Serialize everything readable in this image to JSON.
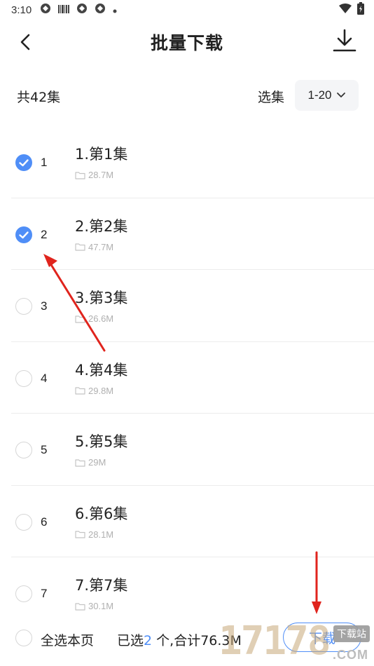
{
  "status_bar": {
    "time": "3:10",
    "left_icons": [
      "sync-icon",
      "barcode-icon",
      "sync-icon",
      "sync-icon",
      "dot-icon"
    ],
    "right_icons": [
      "wifi-icon",
      "battery-icon"
    ]
  },
  "header": {
    "title": "批量下载",
    "back_icon": "chevron-left-icon",
    "download_icon": "download-icon"
  },
  "summary": {
    "total": "共42集",
    "select_label": "选集",
    "range": "1-20"
  },
  "episodes": [
    {
      "index": "1",
      "title": "1.第1集",
      "size": "28.7M",
      "checked": true
    },
    {
      "index": "2",
      "title": "2.第2集",
      "size": "47.7M",
      "checked": true
    },
    {
      "index": "3",
      "title": "3.第3集",
      "size": "26.6M",
      "checked": false
    },
    {
      "index": "4",
      "title": "4.第4集",
      "size": "29.8M",
      "checked": false
    },
    {
      "index": "5",
      "title": "5.第5集",
      "size": "29M",
      "checked": false
    },
    {
      "index": "6",
      "title": "6.第6集",
      "size": "28.1M",
      "checked": false
    },
    {
      "index": "7",
      "title": "7.第7集",
      "size": "30.1M",
      "checked": false
    }
  ],
  "bottom": {
    "select_all": "全选本页",
    "selected_prefix": "已选",
    "selected_count": "2",
    "selected_suffix": " 个,合计76.3M",
    "download_label": "下载"
  },
  "watermark": {
    "number": "17178",
    "site": "下载站",
    "domain": ".COM"
  },
  "colors": {
    "accent": "#4f8ef7",
    "annotation_arrow": "#e0241d",
    "divider": "#ececec",
    "muted_text": "#b0b0b0"
  }
}
